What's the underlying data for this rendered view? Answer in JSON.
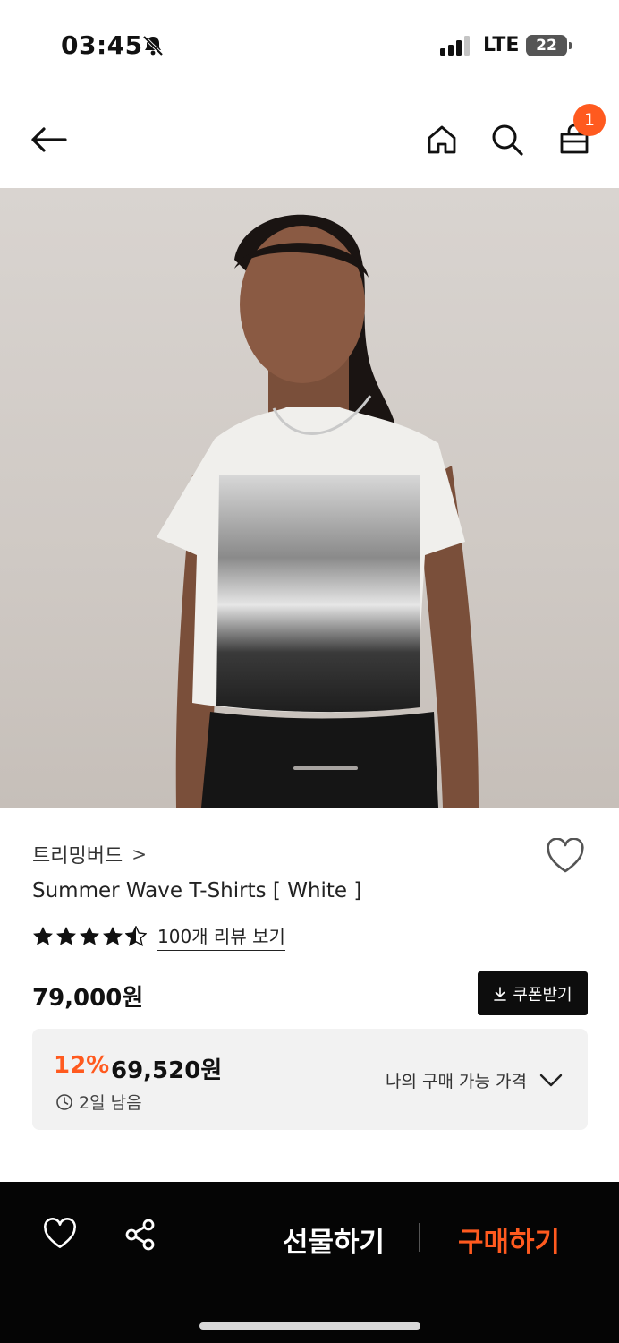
{
  "status_bar": {
    "time": "03:45",
    "network": "LTE",
    "battery": "22"
  },
  "header": {
    "cart_count": "1"
  },
  "product": {
    "brand": "트리밍버드",
    "brand_chevron": ">",
    "title": "Summer Wave T-Shirts [ White ]",
    "rating_stars": 4.5,
    "review_link": "100개 리뷰 보기",
    "price": "79,000원",
    "coupon_button": "쿠폰받기",
    "discount": {
      "percent": "12%",
      "price": "69,520원",
      "remaining": "2일 남음",
      "my_price_label": "나의 구매 가능 가격"
    },
    "image_pager": {
      "current": 1,
      "total": 1
    }
  },
  "bottom_bar": {
    "gift_label": "선물하기",
    "buy_label": "구매하기"
  },
  "colors": {
    "accent": "#ff5a1f",
    "bottom_bar": "#050505",
    "sale_box": "#f2f2f2"
  },
  "icons": [
    "bell-slash-icon",
    "signal-icon",
    "back-arrow-icon",
    "home-icon",
    "search-icon",
    "cart-icon",
    "heart-icon",
    "share-icon",
    "download-icon",
    "clock-icon",
    "chevron-down-icon",
    "star-icon"
  ]
}
